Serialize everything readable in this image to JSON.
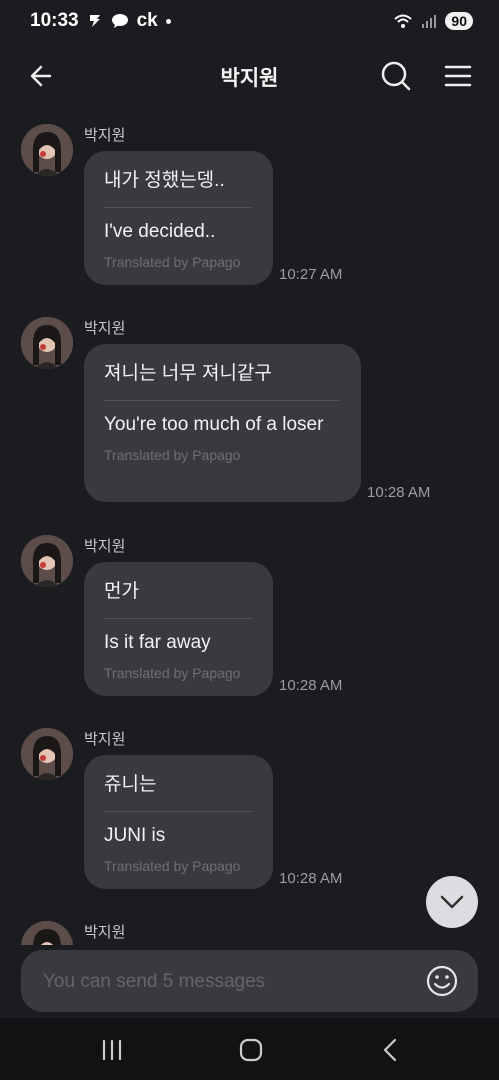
{
  "status_bar": {
    "time": "10:33",
    "carrier_text": "ck",
    "battery": "90"
  },
  "header": {
    "title": "박지원"
  },
  "messages": [
    {
      "sender": "박지원",
      "original": "내가 정했는뎅..",
      "translation": "I've decided..",
      "credit": "Translated by Papago",
      "time": "10:27 AM"
    },
    {
      "sender": "박지원",
      "original": "져니는 너무 져니같구",
      "translation": "You're too much of a loser",
      "credit": "Translated by Papago",
      "time": "10:28 AM"
    },
    {
      "sender": "박지원",
      "original": "먼가",
      "translation": "Is it far away",
      "credit": "Translated by Papago",
      "time": "10:28 AM"
    },
    {
      "sender": "박지원",
      "original": "쥬니는",
      "translation": "JUNI is",
      "credit": "Translated by Papago",
      "time": "10:28 AM"
    },
    {
      "sender": "박지원"
    }
  ],
  "input": {
    "placeholder": "You can send 5 messages"
  },
  "icons": {
    "back": "arrow-left-icon",
    "search": "search-icon",
    "menu": "hamburger-menu-icon",
    "scroll": "chevron-down-icon",
    "emoji": "smiley-icon",
    "nav_recents": "recents-icon",
    "nav_home": "home-icon",
    "nav_back": "back-icon"
  },
  "colors": {
    "background": "#1b1c20",
    "bubble": "#393a40",
    "translated_credit": "#6d6e75"
  }
}
